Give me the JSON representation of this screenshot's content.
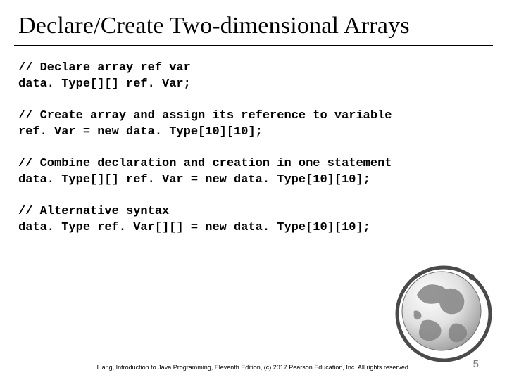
{
  "title": "Declare/Create Two-dimensional Arrays",
  "code": {
    "block1": {
      "comment": "// Declare array ref var",
      "line": "data. Type[][] ref. Var;"
    },
    "block2": {
      "comment": "// Create array and assign its reference to variable",
      "line": "ref. Var = new data. Type[10][10];"
    },
    "block3": {
      "comment": "// Combine declaration and creation in one statement",
      "line": "data. Type[][] ref. Var = new data. Type[10][10];"
    },
    "block4": {
      "comment": "// Alternative syntax",
      "line": "data. Type ref. Var[][] = new data. Type[10][10];"
    }
  },
  "footer": "Liang, Introduction to Java Programming, Eleventh Edition, (c) 2017 Pearson Education, Inc. All rights reserved.",
  "page_number": "5",
  "icons": {
    "globe": "globe-icon"
  }
}
